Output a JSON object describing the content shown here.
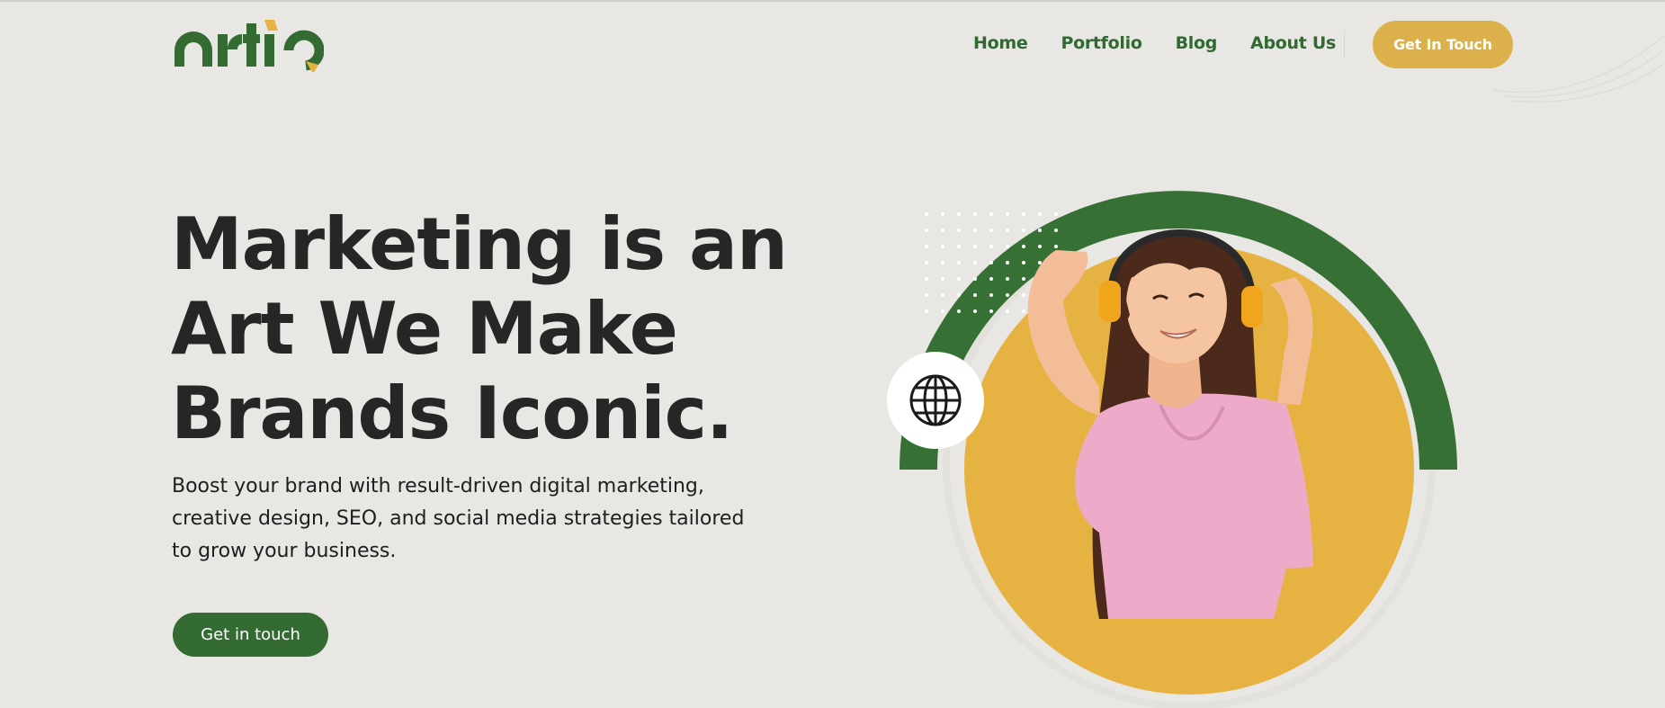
{
  "brand": {
    "name": "artio",
    "colors": {
      "green": "#336b33",
      "yellow": "#e6b342",
      "background": "#e8e7e3",
      "text": "#262626"
    }
  },
  "nav": {
    "items": [
      {
        "label": "Home"
      },
      {
        "label": "Portfolio"
      },
      {
        "label": "Blog"
      },
      {
        "label": "About Us"
      }
    ],
    "cta_label": "Get In Touch"
  },
  "hero": {
    "headline_lines": [
      "Marketing is an",
      "Art We Make",
      "Brands Iconic."
    ],
    "subtext_lines": [
      "Boost your brand with result-driven digital marketing,",
      "creative design, SEO, and social media strategies tailored",
      "to grow your business."
    ],
    "cta_label": "Get in touch",
    "image_subject": "woman with headphones",
    "badge_icon": "globe-icon"
  }
}
